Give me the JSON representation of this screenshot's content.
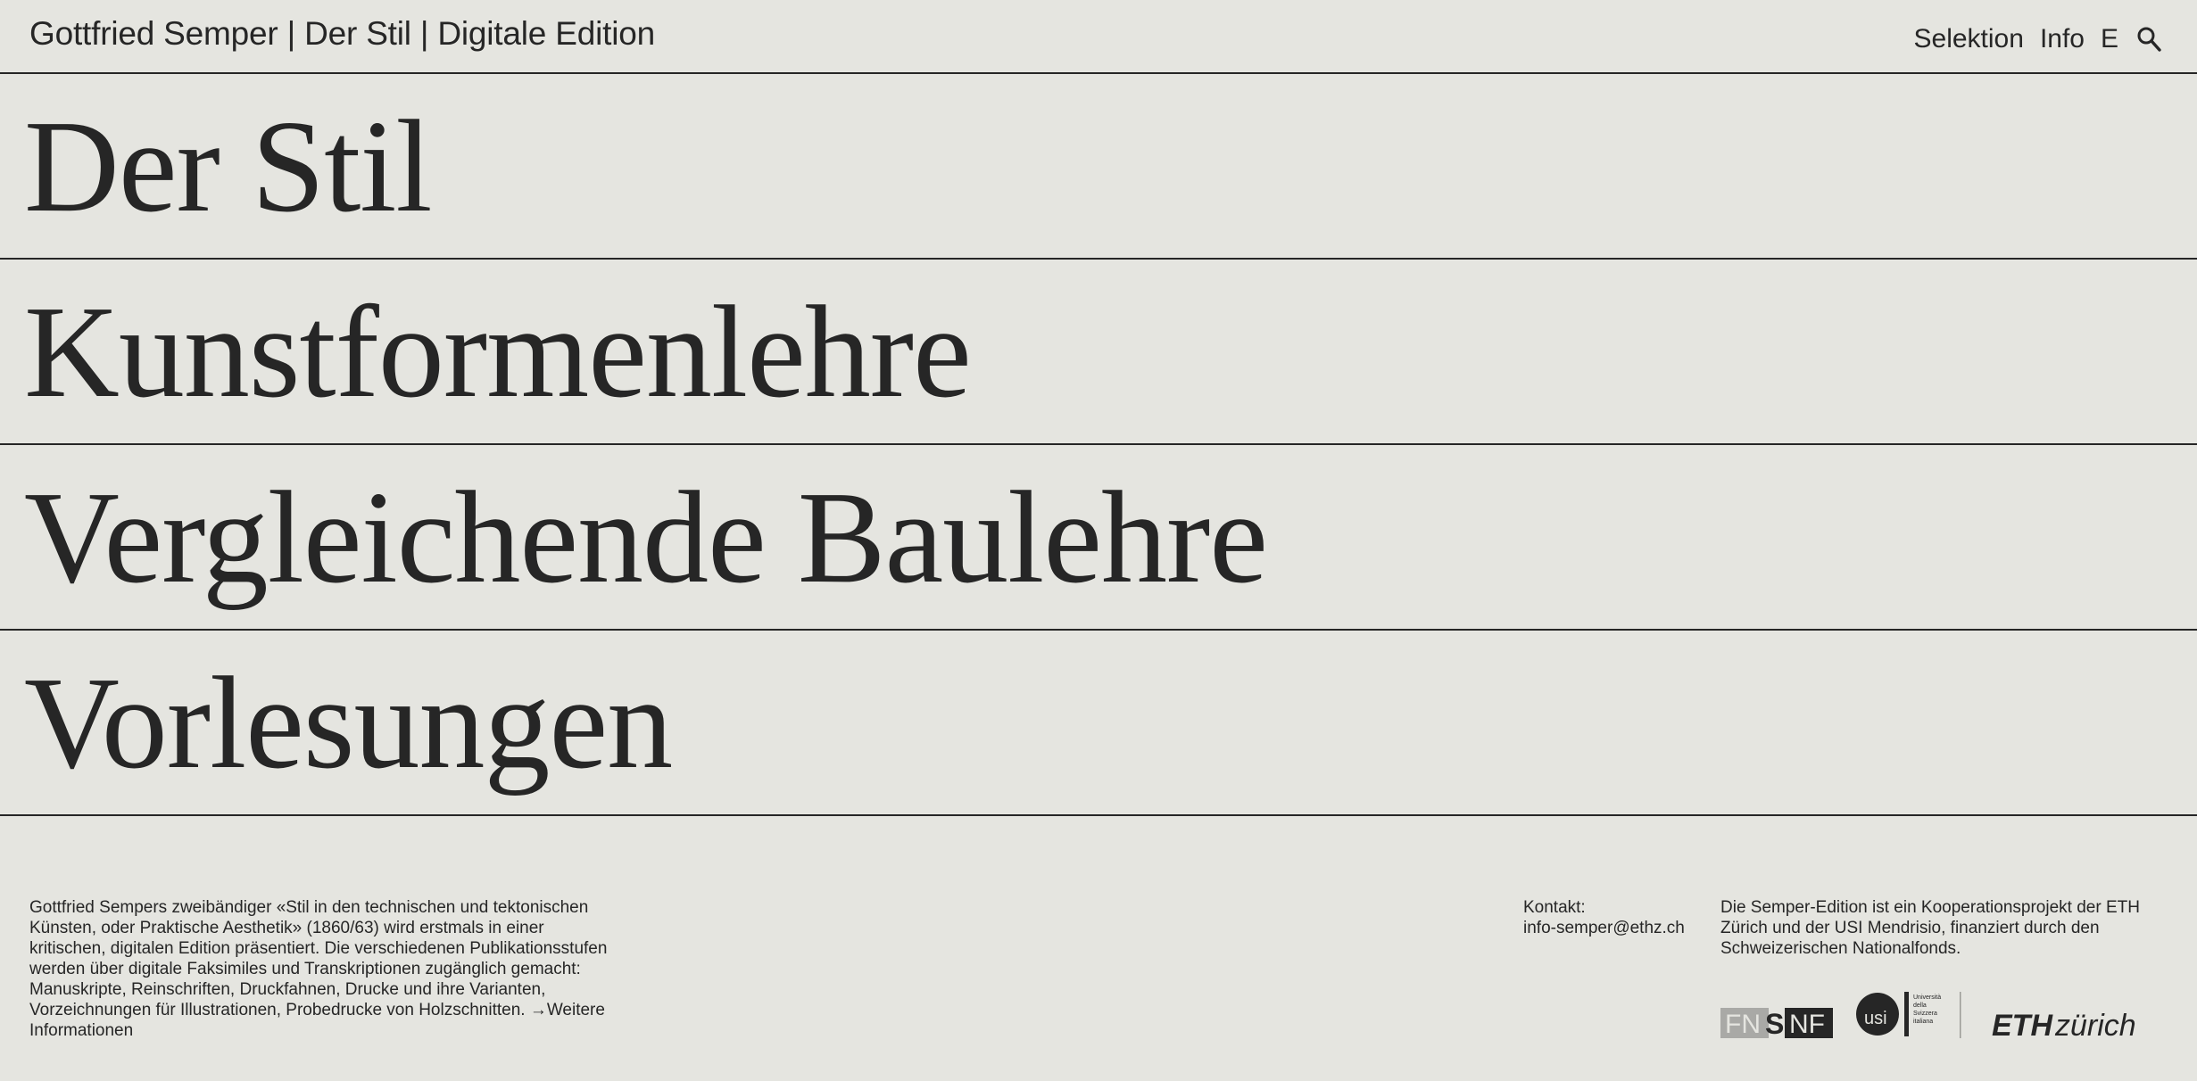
{
  "header": {
    "site_title": "Gottfried Semper | Der Stil | Digitale Edition",
    "nav": {
      "selektion": "Selektion",
      "info": "Info",
      "language": "E",
      "search_icon": "search-icon"
    }
  },
  "sections": [
    {
      "label": "Der Stil"
    },
    {
      "label": "Kunstformenlehre"
    },
    {
      "label": "Vergleichende Baulehre"
    },
    {
      "label": "Vorlesungen"
    }
  ],
  "footer": {
    "description": "Gottfried Sempers zweibändiger «Stil in den technischen und tektonischen Künsten, oder Praktische Aesthetik» (1860/63) wird erstmals in einer kritischen, digitalen Edition präsentiert. Die verschiedenen Publikationsstufen werden über digitale Faksimiles und Transkriptionen zugänglich gemacht: Manuskripte, Reinschriften, Druckfahnen, Drucke und ihre Varianten, Vorzeichnungen für Illustrationen, Probedrucke von Holzschnitten.",
    "more_link": "→Weitere Informationen",
    "contact_label": "Kontakt:",
    "contact_email": "info-semper@ethz.ch",
    "cooperation": "Die Semper-Edition ist ein Kooperationsprojekt der ETH Zürich und der USI Mendrisio, finanziert durch den Schweizerischen Nationalfonds.",
    "logos": {
      "snf": {
        "part1": "FN",
        "part2": "S",
        "part3": "NF"
      },
      "usi": {
        "letters": "usi",
        "text1": "Università",
        "text2": "della",
        "text3": "Svizzera",
        "text4": "italiana"
      },
      "eth": {
        "part1": "ETH",
        "part2": "zürich"
      }
    }
  },
  "colors": {
    "background": "#e5e5e0",
    "text": "#262626",
    "logo_grey": "#a9a9a6"
  }
}
